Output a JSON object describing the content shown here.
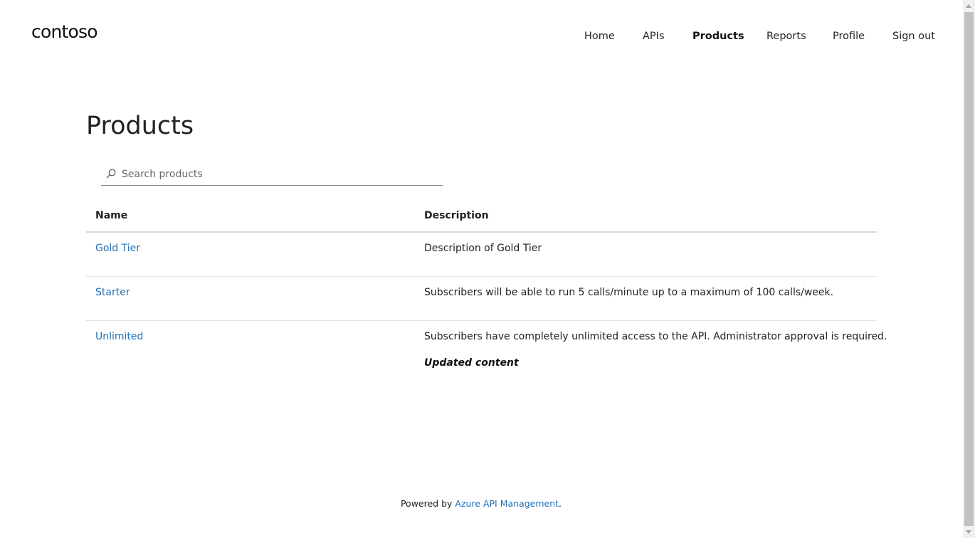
{
  "header": {
    "logo": "contoso",
    "nav": [
      {
        "label": "Home",
        "active": false
      },
      {
        "label": "APIs",
        "active": false
      },
      {
        "label": "Products",
        "active": true
      },
      {
        "label": "Reports",
        "active": false
      },
      {
        "label": "Profile",
        "active": false
      },
      {
        "label": "Sign out",
        "active": false
      }
    ]
  },
  "main": {
    "title": "Products",
    "search": {
      "placeholder": "Search products",
      "value": ""
    },
    "table": {
      "columns": [
        "Name",
        "Description"
      ],
      "rows": [
        {
          "name": "Gold Tier",
          "description": "Description of Gold Tier",
          "extra": ""
        },
        {
          "name": "Starter",
          "description": "Subscribers will be able to run 5 calls/minute up to a maximum of 100 calls/week.",
          "extra": ""
        },
        {
          "name": "Unlimited",
          "description": "Subscribers have completely unlimited access to the API. Administrator approval is required.",
          "extra": "Updated content"
        }
      ]
    }
  },
  "footer": {
    "prefix": "Powered by",
    "link": "Azure API Management",
    "suffix": "."
  },
  "colors": {
    "link": "#1f6fb5",
    "text": "#222222",
    "border": "#d9d9d9"
  }
}
